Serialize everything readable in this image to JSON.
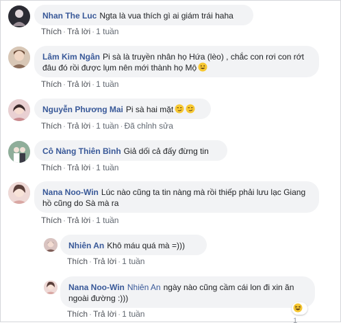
{
  "labels": {
    "like": "Thích",
    "reply": "Trả lời",
    "dot": "·",
    "time": "1 tuần",
    "edited": "Đã chỉnh sửa"
  },
  "comments": [
    {
      "author": "Nhan The Luc",
      "text": "Ngta là vua thích gì ai giám trái haha"
    },
    {
      "author": "Lâm Kim Ngân",
      "text": "Pi sà là truyền nhân họ Hứa (lèo) , chắc con rơi con rớt đâu đó rồi được lụm nên mới thành họ Mộ"
    },
    {
      "author": "Nguyễn Phương Mai",
      "text": "Pi sà hai mặt"
    },
    {
      "author": "Cô Nàng Thiên Bình",
      "text": "Giả dối cả đấy đừng tin"
    },
    {
      "author": "Nana Noo-Win",
      "text": "Lúc nào cũng ta tin nàng mà rồi thiếp phải lưu lạc Giang hồ cũng do Sà mà ra"
    }
  ],
  "replies": [
    {
      "author": "Nhiên An",
      "text": "Khô máu quá mà =)))"
    },
    {
      "author": "Nana Noo-Win",
      "tag": "Nhiên An",
      "text": "ngày nào cũng cầm cái lon đi xin ăn ngoài đường :)))",
      "reaction_count": "1",
      "reaction_icon": "laughing-emoji-icon"
    }
  ]
}
